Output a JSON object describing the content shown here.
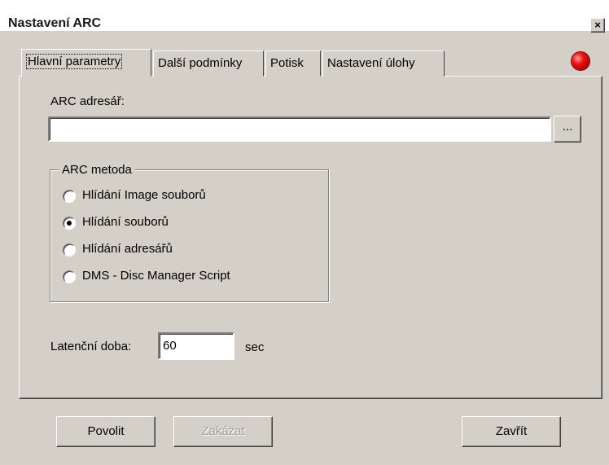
{
  "window": {
    "title": "Nastavení ARC",
    "close_label": "×"
  },
  "tabs": [
    {
      "label": "Hlavní parametry",
      "active": true
    },
    {
      "label": "Další podmínky",
      "active": false
    },
    {
      "label": "Potisk",
      "active": false
    },
    {
      "label": "Nastavení úlohy",
      "active": false
    }
  ],
  "status_indicator": {
    "icon": "red-led-icon",
    "color": "#e00000"
  },
  "arc_directory": {
    "label": "ARC adresář:",
    "value": "",
    "browse_label": "..."
  },
  "arc_method": {
    "legend": "ARC metoda",
    "options": [
      {
        "label": "Hlídání Image souborů",
        "checked": false
      },
      {
        "label": "Hlídání souborů",
        "checked": true
      },
      {
        "label": "Hlídání adresářů",
        "checked": false
      },
      {
        "label": "DMS - Disc Manager Script",
        "checked": false
      }
    ]
  },
  "latency": {
    "label": "Latenční doba:",
    "value": "60",
    "unit": "sec"
  },
  "buttons": {
    "enable": "Povolit",
    "disable": "Zakázat",
    "close": "Zavřít"
  }
}
